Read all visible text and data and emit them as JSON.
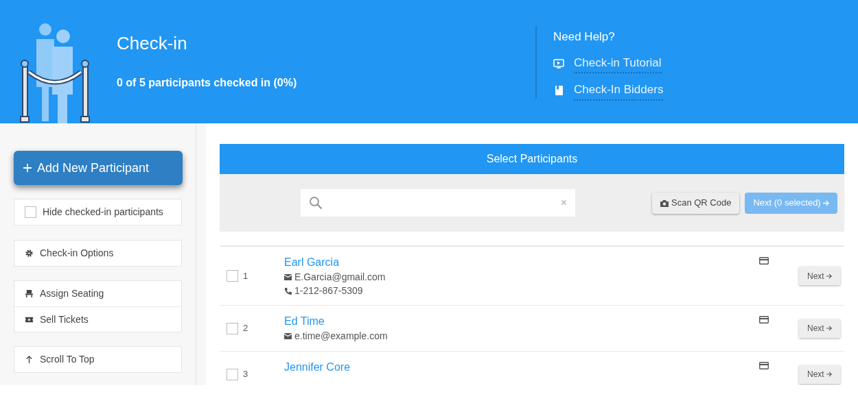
{
  "header": {
    "title": "Check-in",
    "summary": "0 of 5 participants checked in (0%)",
    "help_title": "Need Help?",
    "help_links": [
      {
        "kind": "video",
        "label": "Check-in Tutorial"
      },
      {
        "kind": "book",
        "label": "Check-In Bidders"
      }
    ]
  },
  "sidebar": {
    "add_button": "Add New Participant",
    "hide_checked": {
      "label": "Hide checked-in participants",
      "checked": false
    },
    "groups": [
      [
        {
          "kind": "gear",
          "label": "Check-in Options"
        }
      ],
      [
        {
          "kind": "seat",
          "label": "Assign Seating"
        },
        {
          "kind": "ticket",
          "label": "Sell Tickets"
        }
      ],
      [
        {
          "kind": "up",
          "label": "Scroll To Top"
        }
      ]
    ]
  },
  "panel": {
    "title": "Select Participants",
    "clear": "×",
    "scan_button": "Scan QR Code",
    "next_button": "Next (0 selected)"
  },
  "participants": [
    {
      "number": "1",
      "name": "Earl Garcia",
      "email": "E.Garcia@gmail.com",
      "phone": "1-212-867-5309",
      "checked": false,
      "next": "Next"
    },
    {
      "number": "2",
      "name": "Ed Time",
      "email": "e.time@example.com",
      "checked": false,
      "next": "Next"
    },
    {
      "number": "3",
      "name": "Jennifer Core",
      "checked": false,
      "next": "Next"
    }
  ]
}
